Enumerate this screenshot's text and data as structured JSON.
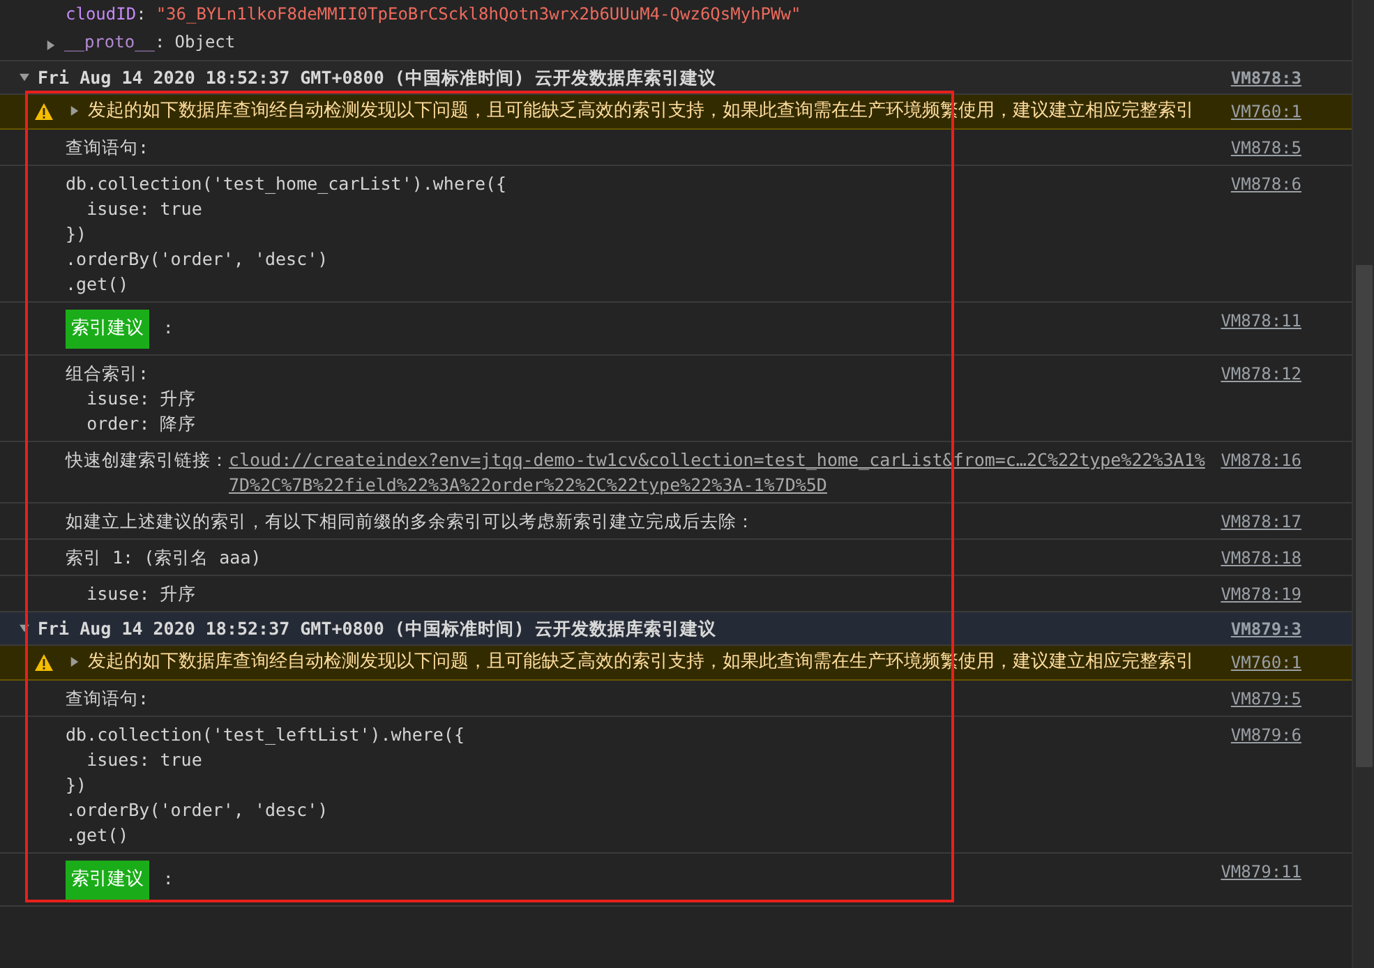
{
  "properties": [
    {
      "key": "cloudID",
      "separator": ":",
      "value": "\"36_BYLn1lkoF8deMMII0TpEoBrCSckl8hQotn3wrx2b6UUuM4-Qwz6QsMyhPWw\""
    }
  ],
  "proto": {
    "label": "__proto__",
    "separator": ":",
    "value": "Object",
    "expanded": false
  },
  "groups": [
    {
      "title": "Fri Aug 14 2020 18:52:37 GMT+0800 (中国标准时间) 云开发数据库索引建议",
      "source": "VM878:3",
      "expanded": true,
      "selected": false,
      "messages": [
        {
          "kind": "warning",
          "expanded": false,
          "text": "发起的如下数据库查询经自动检测发现以下问题，且可能缺乏高效的索引支持，如果此查询需在生产环境频繁使用，建议建立相应完整索引",
          "source": "VM760:1"
        },
        {
          "kind": "lines",
          "lines": [
            "查询语句:"
          ],
          "source": "VM878:5"
        },
        {
          "kind": "lines",
          "lines": [
            "db.collection('test_home_carList').where({",
            "  isuse: true",
            "})",
            ".orderBy('order', 'desc')",
            ".get()"
          ],
          "source": "VM878:6"
        },
        {
          "kind": "badge",
          "label": "索引建议",
          "suffix": ":",
          "source": "VM878:11"
        },
        {
          "kind": "lines",
          "lines": [
            "组合索引:",
            "  isuse: 升序",
            "  order: 降序"
          ],
          "source": "VM878:12"
        },
        {
          "kind": "link",
          "label": "快速创建索引链接：",
          "url": "cloud://createindex?env=jtqq-demo-tw1cv&collection=test_home_carList&from=c…2C%22type%22%3A1%7D%2C%7B%22field%22%3A%22order%22%2C%22type%22%3A-1%7D%5D",
          "source": "VM878:16"
        },
        {
          "kind": "lines",
          "lines": [
            "如建立上述建议的索引，有以下相同前缀的多余索引可以考虑新索引建立完成后去除："
          ],
          "source": "VM878:17"
        },
        {
          "kind": "lines",
          "lines": [
            "索引 1: (索引名 aaa)"
          ],
          "source": "VM878:18"
        },
        {
          "kind": "lines",
          "lines": [
            "  isuse: 升序"
          ],
          "source": "VM878:19"
        }
      ]
    },
    {
      "title": "Fri Aug 14 2020 18:52:37 GMT+0800 (中国标准时间) 云开发数据库索引建议",
      "source": "VM879:3",
      "expanded": true,
      "selected": true,
      "messages": [
        {
          "kind": "warning",
          "expanded": false,
          "text": "发起的如下数据库查询经自动检测发现以下问题，且可能缺乏高效的索引支持，如果此查询需在生产环境频繁使用，建议建立相应完整索引",
          "source": "VM760:1"
        },
        {
          "kind": "lines",
          "lines": [
            "查询语句:"
          ],
          "source": "VM879:5"
        },
        {
          "kind": "lines",
          "lines": [
            "db.collection('test_leftList').where({",
            "  isues: true",
            "})",
            ".orderBy('order', 'desc')",
            ".get()"
          ],
          "source": "VM879:6"
        },
        {
          "kind": "badge",
          "label": "索引建议",
          "suffix": ":",
          "source": "VM879:11"
        }
      ]
    }
  ]
}
